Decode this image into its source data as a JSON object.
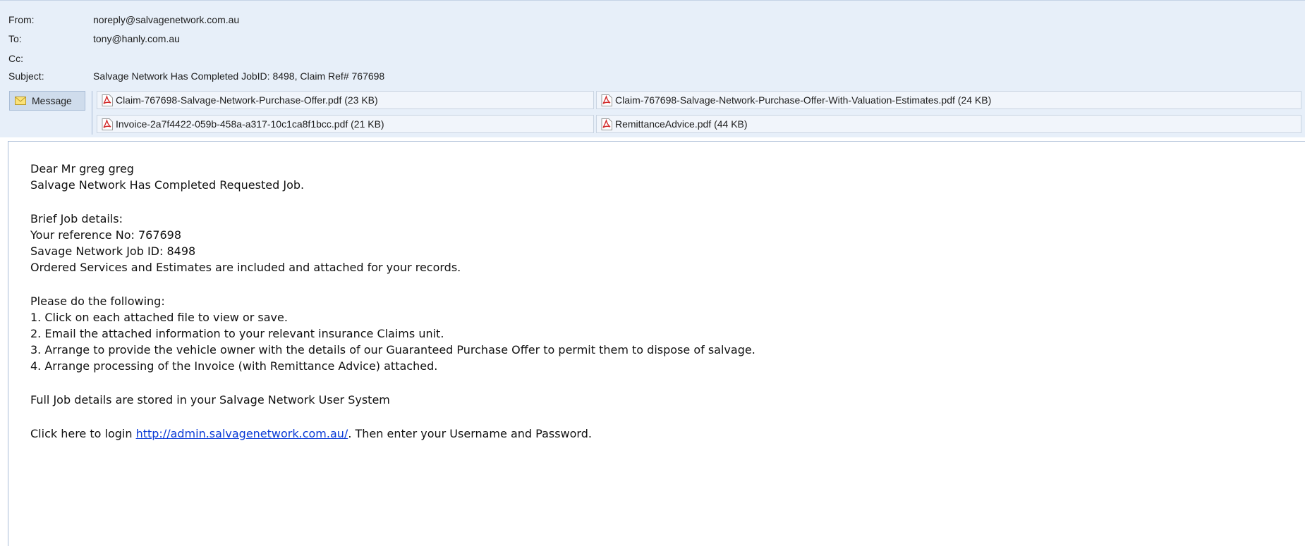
{
  "header": {
    "from_label": "From:",
    "from_value": "noreply@salvagenetwork.com.au",
    "to_label": "To:",
    "to_value": "tony@hanly.com.au",
    "cc_label": "Cc:",
    "cc_value": "",
    "subject_label": "Subject:",
    "subject_value": "Salvage Network Has Completed JobID: 8498, Claim Ref# 767698"
  },
  "tabs": {
    "message_label": "Message",
    "message_icon": "envelope-icon"
  },
  "attachments": [
    {
      "name": "Claim-767698-Salvage-Network-Purchase-Offer.pdf (23 KB)",
      "icon": "pdf-icon"
    },
    {
      "name": "Claim-767698-Salvage-Network-Purchase-Offer-With-Valuation-Estimates.pdf (24 KB)",
      "icon": "pdf-icon"
    },
    {
      "name": "Invoice-2a7f4422-059b-458a-a317-10c1ca8f1bcc.pdf (21 KB)",
      "icon": "pdf-icon"
    },
    {
      "name": "RemittanceAdvice.pdf (44 KB)",
      "icon": "pdf-icon"
    }
  ],
  "body": {
    "greeting": "Dear Mr greg greg",
    "intro": "Salvage Network Has Completed Requested Job.",
    "brief_heading": "Brief Job details:",
    "reference": "Your reference No: 767698",
    "job_id": "Savage Network Job ID: 8498",
    "ordered": "Ordered Services and Estimates are included and attached for your records.",
    "please": "Please do the following:",
    "step1": "1. Click on each attached file to view or save.",
    "step2": "2. Email the attached information to your relevant insurance Claims unit.",
    "step3": "3. Arrange to provide the vehicle owner with the details of our Guaranteed Purchase Offer to permit them to dispose of salvage.",
    "step4": "4. Arrange processing of the Invoice (with Remittance Advice) attached.",
    "stored": "Full Job details are stored in your Salvage Network User System",
    "login_prefix": "Click here to login ",
    "login_link": "http://admin.salvagenetwork.com.au/",
    "login_suffix": ". Then enter your Username and Password."
  },
  "colors": {
    "header_bg": "#e7eff9",
    "link": "#0a3bd6",
    "pdf_red": "#d22a2a"
  }
}
